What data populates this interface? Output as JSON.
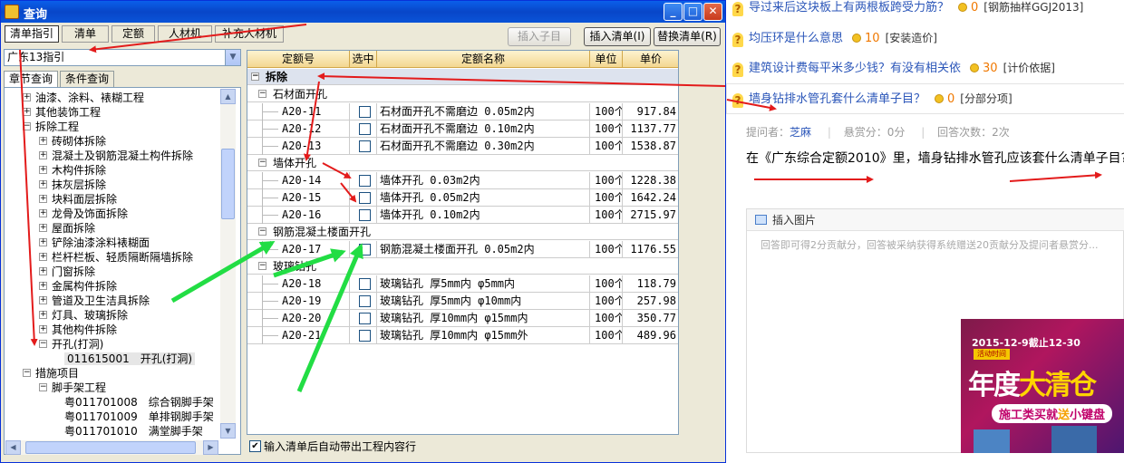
{
  "window": {
    "title": "查询",
    "min": "_",
    "max": "□",
    "close": "✕"
  },
  "toolbar": {
    "tabs": [
      "清单指引",
      "清单",
      "定额",
      "人材机",
      "补充人材机"
    ],
    "insert_sub": "插入子目",
    "insert_list": "插入清单(I)",
    "replace_list": "替换清单(R)"
  },
  "library": {
    "value": "广东13指引"
  },
  "left_tabs": [
    "章节查询",
    "条件查询"
  ],
  "tree": [
    {
      "label": "油漆、涂料、裱糊工程",
      "exp": "+"
    },
    {
      "label": "其他装饰工程",
      "exp": "+"
    },
    {
      "label": "拆除工程",
      "exp": "−"
    },
    {
      "label": "砖砌体拆除",
      "exp": "+"
    },
    {
      "label": "混凝土及钢筋混凝土构件拆除",
      "exp": "+"
    },
    {
      "label": "木构件拆除",
      "exp": "+"
    },
    {
      "label": "抹灰层拆除",
      "exp": "+"
    },
    {
      "label": "块料面层拆除",
      "exp": "+"
    },
    {
      "label": "龙骨及饰面拆除",
      "exp": "+"
    },
    {
      "label": "屋面拆除",
      "exp": "+"
    },
    {
      "label": "铲除油漆涂料裱糊面",
      "exp": "+"
    },
    {
      "label": "栏杆栏板、轻质隔断隔墙拆除",
      "exp": "+"
    },
    {
      "label": "门窗拆除",
      "exp": "+"
    },
    {
      "label": "金属构件拆除",
      "exp": "+"
    },
    {
      "label": "管道及卫生洁具拆除",
      "exp": "+"
    },
    {
      "label": "灯具、玻璃拆除",
      "exp": "+"
    },
    {
      "label": "其他构件拆除",
      "exp": "+"
    },
    {
      "label": "开孔(打洞)",
      "exp": "−"
    },
    {
      "label": "011615001　开孔(打洞)",
      "exp": ""
    },
    {
      "label": "措施项目",
      "exp": "−"
    },
    {
      "label": "脚手架工程",
      "exp": "−"
    },
    {
      "label": "粤011701008　综合钢脚手架",
      "exp": ""
    },
    {
      "label": "粤011701009　单排钢脚手架",
      "exp": ""
    },
    {
      "label": "粤011701010　满堂脚手架",
      "exp": ""
    }
  ],
  "grid": {
    "headers": [
      "定额号",
      "选中",
      "定额名称",
      "单位",
      "单价"
    ],
    "top_group": "拆除",
    "groups": [
      {
        "name": "石材面开孔",
        "rows": [
          {
            "code": "A20-11",
            "name": "石材面开孔不需磨边 0.05m2内",
            "unit": "100个",
            "price": "917.84"
          },
          {
            "code": "A20-12",
            "name": "石材面开孔不需磨边 0.10m2内",
            "unit": "100个",
            "price": "1137.77"
          },
          {
            "code": "A20-13",
            "name": "石材面开孔不需磨边 0.30m2内",
            "unit": "100个",
            "price": "1538.87"
          }
        ]
      },
      {
        "name": "墙体开孔",
        "rows": [
          {
            "code": "A20-14",
            "name": "墙体开孔 0.03m2内",
            "unit": "100个",
            "price": "1228.38"
          },
          {
            "code": "A20-15",
            "name": "墙体开孔 0.05m2内",
            "unit": "100个",
            "price": "1642.24"
          },
          {
            "code": "A20-16",
            "name": "墙体开孔 0.10m2内",
            "unit": "100个",
            "price": "2715.97"
          }
        ]
      },
      {
        "name": "钢筋混凝土楼面开孔",
        "rows": [
          {
            "code": "A20-17",
            "name": "钢筋混凝土楼面开孔 0.05m2内",
            "unit": "100个",
            "price": "1176.55"
          }
        ]
      },
      {
        "name": "玻璃钻孔",
        "rows": [
          {
            "code": "A20-18",
            "name": "玻璃钻孔 厚5mm内 φ5mm内",
            "unit": "100个",
            "price": "118.79"
          },
          {
            "code": "A20-19",
            "name": "玻璃钻孔 厚5mm内 φ10mm内",
            "unit": "100个",
            "price": "257.98"
          },
          {
            "code": "A20-20",
            "name": "玻璃钻孔 厚10mm内 φ15mm内",
            "unit": "100个",
            "price": "350.77"
          },
          {
            "code": "A20-21",
            "name": "玻璃钻孔 厚10mm内 φ15mm外",
            "unit": "100个",
            "price": "489.96"
          }
        ]
      }
    ]
  },
  "auto_check": {
    "label": "输入清单后自动带出工程内容行",
    "checked": true
  },
  "right": {
    "questions": [
      {
        "title": "导过来后这块板上有两根板跨受力筋？",
        "points": "0",
        "category": "[钢筋抽样GGJ2013]"
      },
      {
        "title": "均压环是什么意思",
        "points": "10",
        "category": "[安装造价]"
      },
      {
        "title": "建筑设计费每平米多少钱？有没有相关依",
        "points": "30",
        "category": "[计价依据]"
      },
      {
        "title": "墙身钻排水管孔套什么清单子目？",
        "points": "0",
        "category": "[分部分项]"
      }
    ],
    "asker_label": "提问者：",
    "asker_name": "芝麻",
    "reward": "悬赏分：0分",
    "answers": "回答次数：2次",
    "question_body": "在《广东综合定额2010》里，墙身钻排水管孔应该套什么清单子目?",
    "editor_bar": "插入图片",
    "editor_placeholder": "回答即可得2分贡献分，回答被采纳获得系统赠送20贡献分及提问者悬赏分..."
  },
  "ad": {
    "date": "2015-12-9截止12-30",
    "tag": "活动时间",
    "big1": "年度",
    "big2": "大清仓",
    "sub1": "施工类买就",
    "sub2": "送",
    "sub3": "小键盘"
  },
  "colors": {
    "red_arrow": "#e31b1b",
    "green_arrow": "#22dd44",
    "link": "#2b56b9"
  }
}
